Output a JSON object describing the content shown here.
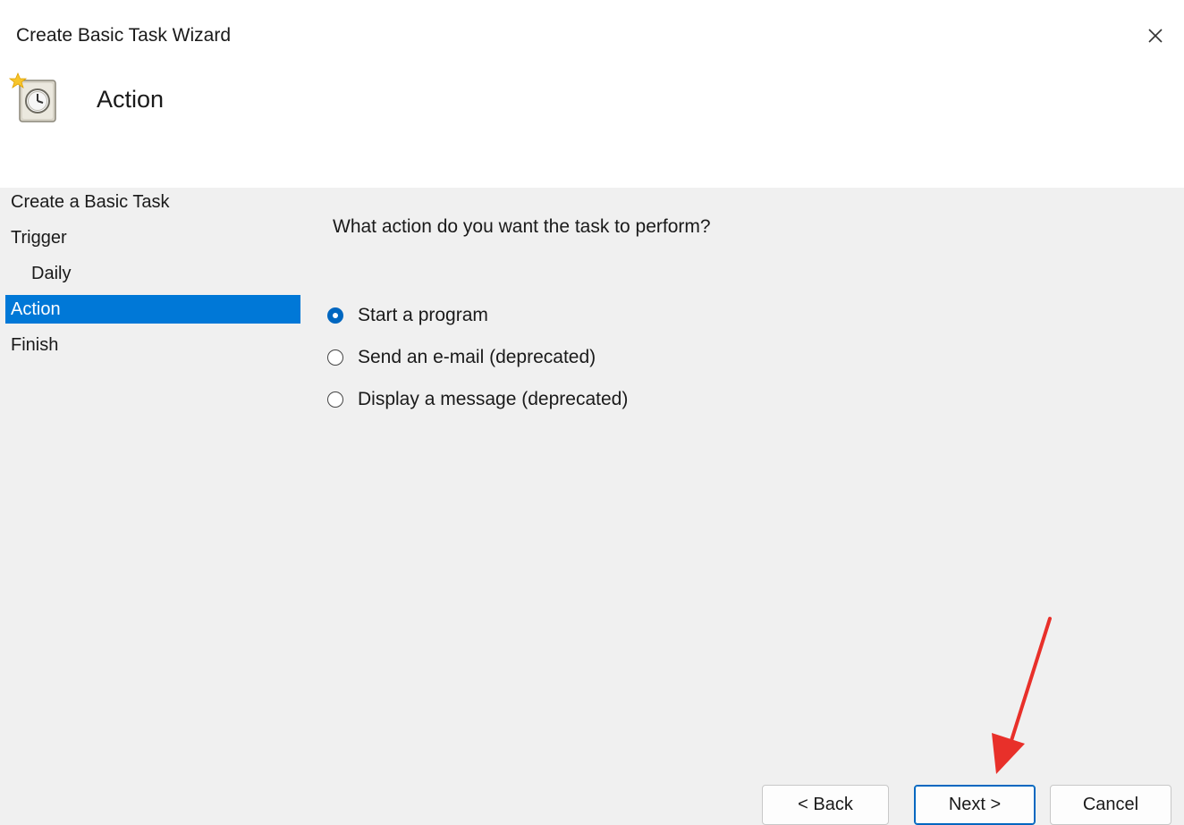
{
  "window": {
    "title": "Create Basic Task Wizard",
    "close_icon": "close-icon"
  },
  "header": {
    "icon": "task-scheduler-clock-icon",
    "title": "Action"
  },
  "sidebar": {
    "items": [
      {
        "label": "Create a Basic Task",
        "active": false,
        "sub": false
      },
      {
        "label": "Trigger",
        "active": false,
        "sub": false
      },
      {
        "label": "Daily",
        "active": false,
        "sub": true
      },
      {
        "label": "Action",
        "active": true,
        "sub": false
      },
      {
        "label": "Finish",
        "active": false,
        "sub": false
      }
    ]
  },
  "main": {
    "question": "What action do you want the task to perform?",
    "options": [
      {
        "label": "Start a program",
        "checked": true
      },
      {
        "label": "Send an e-mail (deprecated)",
        "checked": false
      },
      {
        "label": "Display a message (deprecated)",
        "checked": false
      }
    ]
  },
  "buttons": {
    "back_label": "< Back",
    "next_label": "Next >",
    "cancel_label": "Cancel"
  },
  "colors": {
    "selection": "#0078d7",
    "radio_checked": "#0067c0",
    "annotation_arrow": "#e8302a",
    "panel_background": "#f0f0f0"
  }
}
